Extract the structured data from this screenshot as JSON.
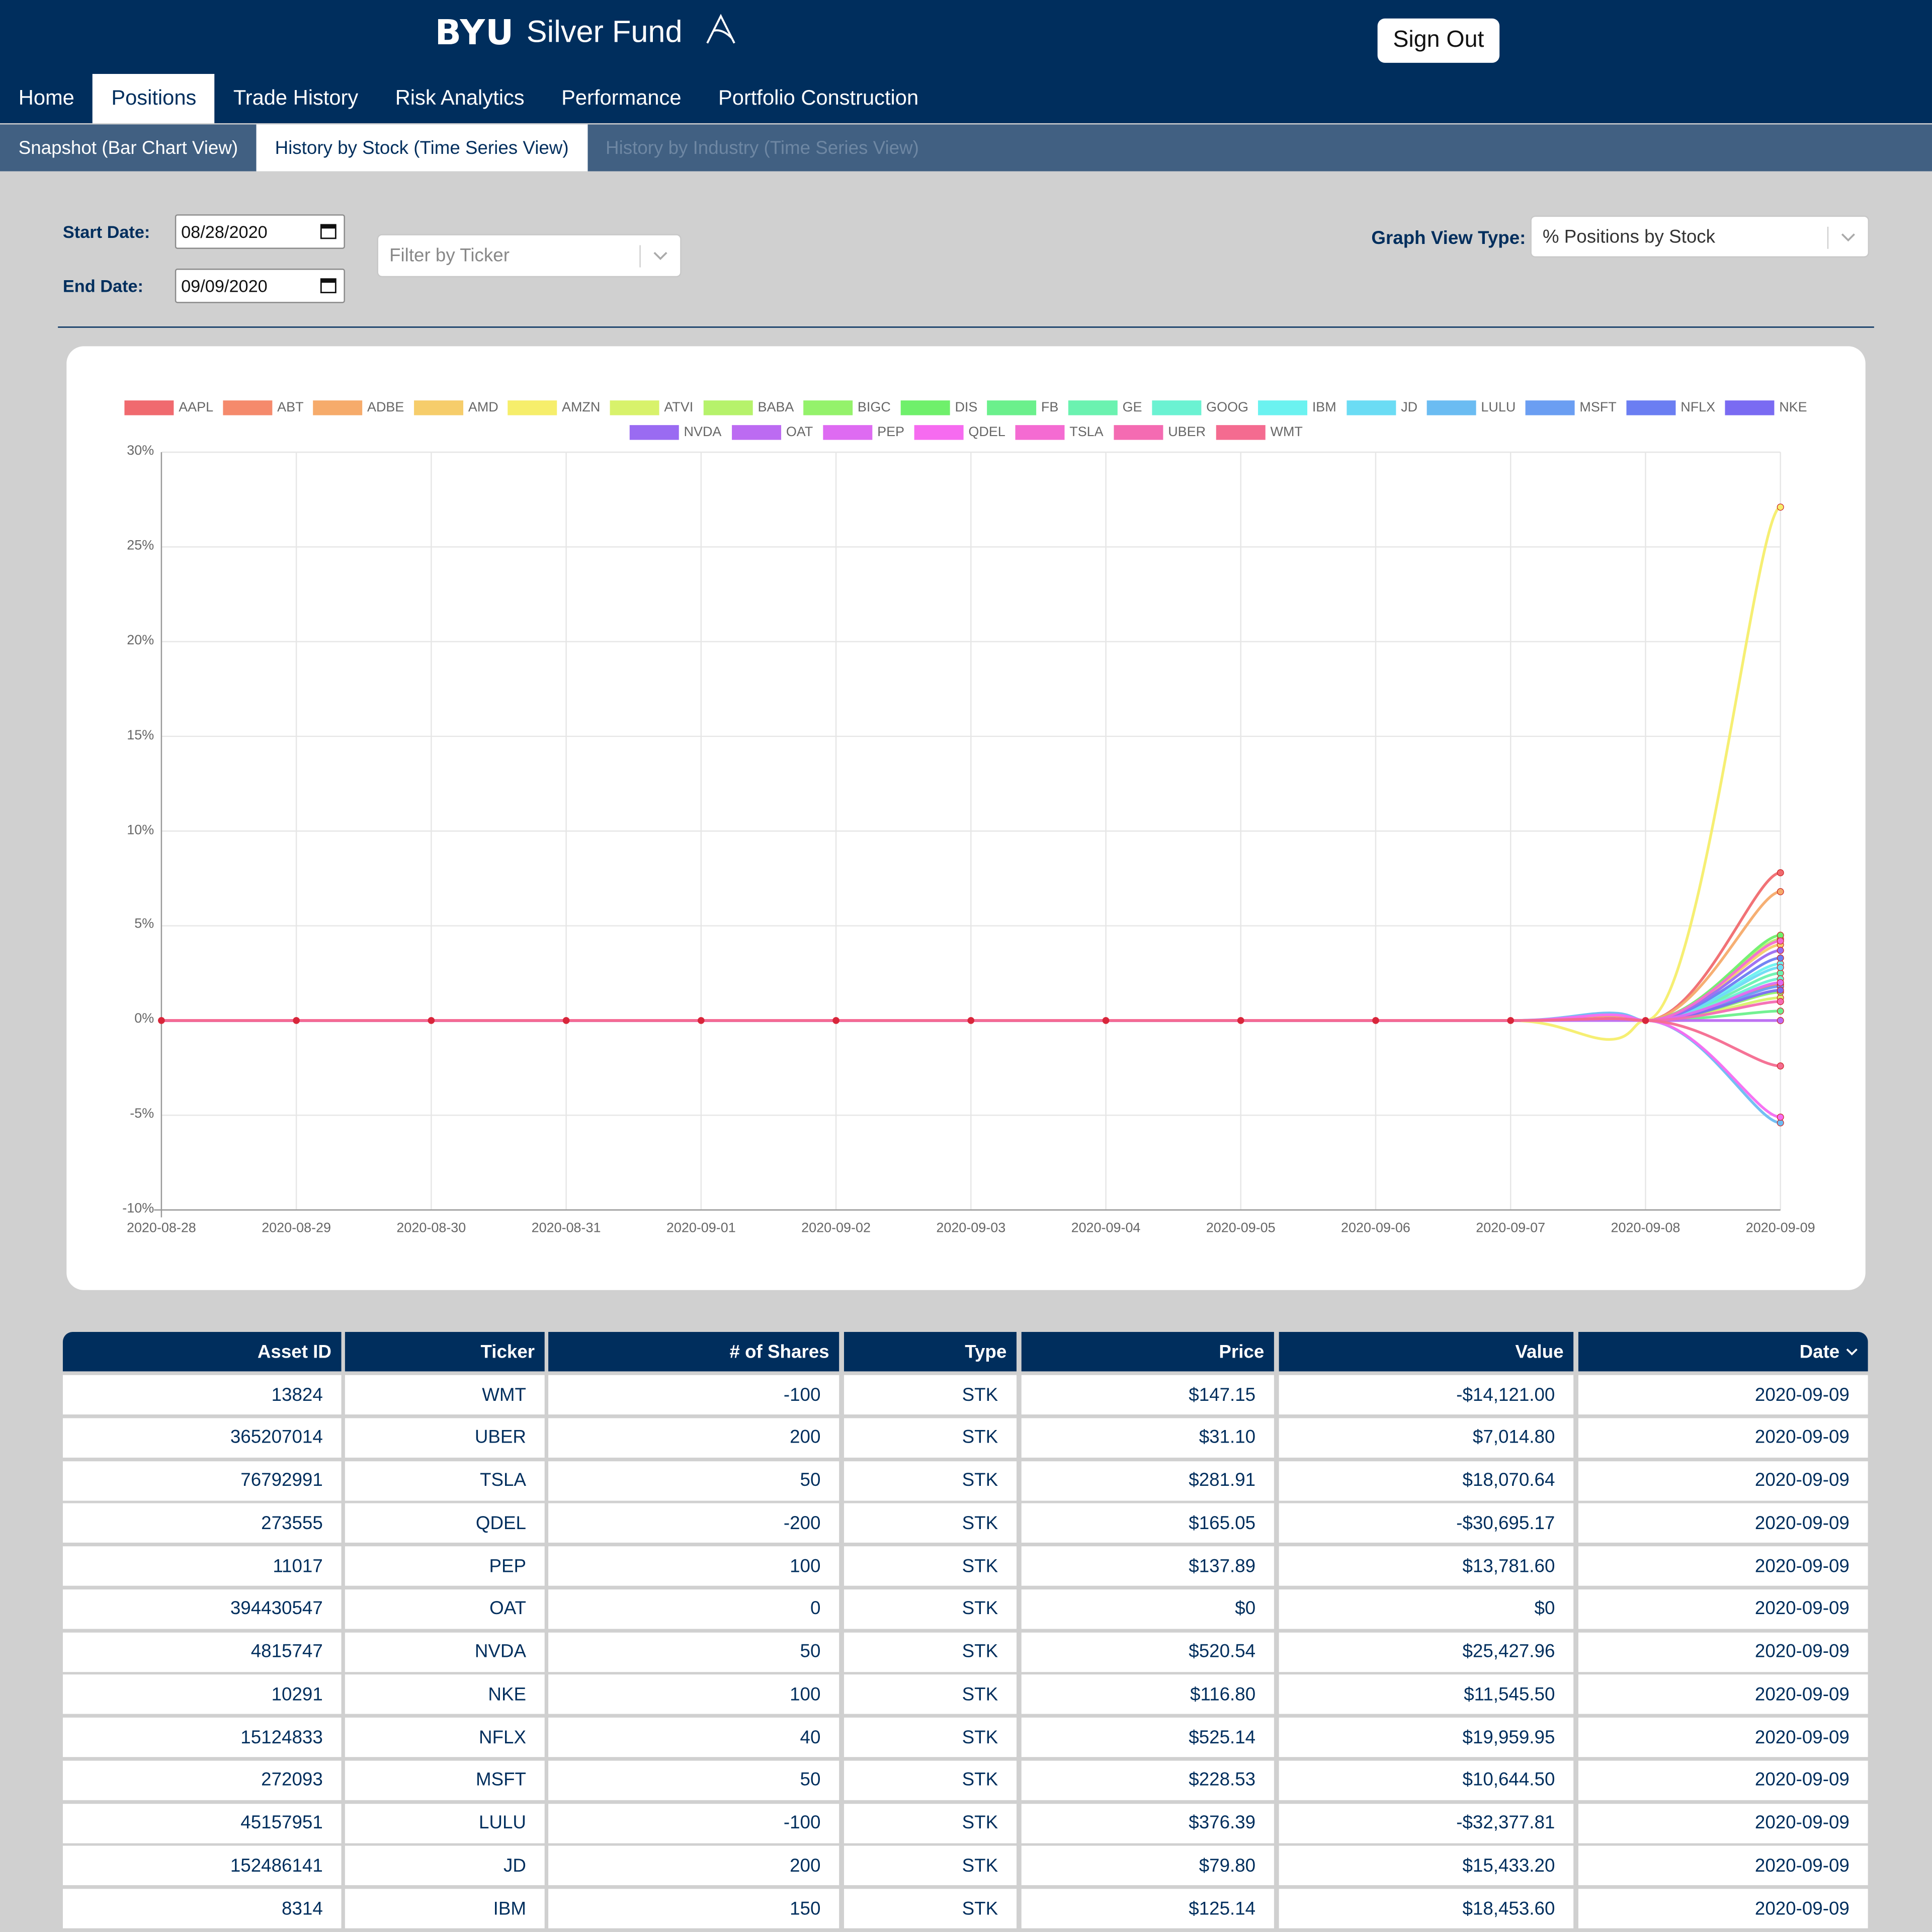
{
  "header": {
    "brand_byu": "BYU",
    "brand_name": "Silver Fund",
    "sign_out": "Sign Out",
    "bg_color": "#002e5d"
  },
  "nav": {
    "items": [
      "Home",
      "Positions",
      "Trade History",
      "Risk Analytics",
      "Performance",
      "Portfolio Construction"
    ],
    "active": "Positions"
  },
  "subnav": {
    "items": [
      "Snapshot (Bar Chart View)",
      "History by Stock (Time Series View)",
      "History by Industry (Time Series View)"
    ],
    "active": "History by Stock (Time Series View)"
  },
  "filters": {
    "start_label": "Start Date:",
    "start_value": "08/28/2020",
    "end_label": "End Date:",
    "end_value": "09/09/2020",
    "ticker_placeholder": "Filter by Ticker",
    "graph_view_label": "Graph View Type:",
    "graph_view_value": "% Positions by Stock"
  },
  "chart_data": {
    "type": "line",
    "x": [
      "2020-08-28",
      "2020-08-29",
      "2020-08-30",
      "2020-08-31",
      "2020-09-01",
      "2020-09-02",
      "2020-09-03",
      "2020-09-04",
      "2020-09-05",
      "2020-09-06",
      "2020-09-07",
      "2020-09-08",
      "2020-09-09"
    ],
    "ylim": [
      -10,
      30
    ],
    "yticks": [
      "30%",
      "25%",
      "20%",
      "15%",
      "10%",
      "5%",
      "0%",
      "-5%",
      "-10%"
    ],
    "grid": true,
    "legend_position": "top",
    "series": [
      {
        "name": "AAPL",
        "color": "#f06a6f",
        "dip": 0.2,
        "final": 7.8
      },
      {
        "name": "ABT",
        "color": "#f58a6c",
        "dip": 0.1,
        "final": 1.9
      },
      {
        "name": "ADBE",
        "color": "#f6ab6b",
        "dip": 0.2,
        "final": 6.8
      },
      {
        "name": "AMD",
        "color": "#f6cd6b",
        "dip": 0.1,
        "final": 4.0
      },
      {
        "name": "AMZN",
        "color": "#f6ee6b",
        "dip": -1.0,
        "final": 27.1
      },
      {
        "name": "ATVI",
        "color": "#d8f26b",
        "dip": 0.1,
        "final": 1.2
      },
      {
        "name": "BABA",
        "color": "#b6f26b",
        "dip": 0.1,
        "final": 4.3
      },
      {
        "name": "BIGC",
        "color": "#94f26b",
        "dip": 0.1,
        "final": 1.5
      },
      {
        "name": "DIS",
        "color": "#6ff06b",
        "dip": 0.1,
        "final": 4.5
      },
      {
        "name": "FB",
        "color": "#6bf08c",
        "dip": 0.1,
        "final": 0.5
      },
      {
        "name": "GE",
        "color": "#6bf2b0",
        "dip": 0.1,
        "final": 2.5
      },
      {
        "name": "GOOG",
        "color": "#6bf2d2",
        "dip": 0.1,
        "final": 2.2
      },
      {
        "name": "IBM",
        "color": "#6bf2f0",
        "dip": 0.1,
        "final": 3.0
      },
      {
        "name": "JD",
        "color": "#6bdcf4",
        "dip": 0.1,
        "final": 2.8
      },
      {
        "name": "LULU",
        "color": "#6bbcf2",
        "dip": 0.4,
        "final": -5.4
      },
      {
        "name": "MSFT",
        "color": "#6b9ef2",
        "dip": 0.1,
        "final": 1.8
      },
      {
        "name": "NFLX",
        "color": "#6b7ef2",
        "dip": 0.1,
        "final": 3.3
      },
      {
        "name": "NKE",
        "color": "#7a6bf2",
        "dip": 0.1,
        "final": 1.6
      },
      {
        "name": "NVDA",
        "color": "#9a6bf2",
        "dip": 0.1,
        "final": 3.7
      },
      {
        "name": "OAT",
        "color": "#bc6bf2",
        "dip": 0.0,
        "final": 0.0
      },
      {
        "name": "PEP",
        "color": "#de6bf2",
        "dip": 0.1,
        "final": 2.0
      },
      {
        "name": "QDEL",
        "color": "#f66bf0",
        "dip": 0.3,
        "final": -5.1
      },
      {
        "name": "TSLA",
        "color": "#f46bd2",
        "dip": 0.1,
        "final": 4.2
      },
      {
        "name": "UBER",
        "color": "#f46bb2",
        "dip": 0.1,
        "final": 1.0
      },
      {
        "name": "WMT",
        "color": "#f46b90",
        "dip": 0.1,
        "final": -2.4
      }
    ]
  },
  "table": {
    "headers": [
      "Asset ID",
      "Ticker",
      "# of Shares",
      "Type",
      "Price",
      "Value",
      "Date"
    ],
    "sort_column": "Date",
    "rows": [
      [
        "13824",
        "WMT",
        "-100",
        "STK",
        "$147.15",
        "-$14,121.00",
        "2020-09-09"
      ],
      [
        "365207014",
        "UBER",
        "200",
        "STK",
        "$31.10",
        "$7,014.80",
        "2020-09-09"
      ],
      [
        "76792991",
        "TSLA",
        "50",
        "STK",
        "$281.91",
        "$18,070.64",
        "2020-09-09"
      ],
      [
        "273555",
        "QDEL",
        "-200",
        "STK",
        "$165.05",
        "-$30,695.17",
        "2020-09-09"
      ],
      [
        "11017",
        "PEP",
        "100",
        "STK",
        "$137.89",
        "$13,781.60",
        "2020-09-09"
      ],
      [
        "394430547",
        "OAT",
        "0",
        "STK",
        "$0",
        "$0",
        "2020-09-09"
      ],
      [
        "4815747",
        "NVDA",
        "50",
        "STK",
        "$520.54",
        "$25,427.96",
        "2020-09-09"
      ],
      [
        "10291",
        "NKE",
        "100",
        "STK",
        "$116.80",
        "$11,545.50",
        "2020-09-09"
      ],
      [
        "15124833",
        "NFLX",
        "40",
        "STK",
        "$525.14",
        "$19,959.95",
        "2020-09-09"
      ],
      [
        "272093",
        "MSFT",
        "50",
        "STK",
        "$228.53",
        "$10,644.50",
        "2020-09-09"
      ],
      [
        "45157951",
        "LULU",
        "-100",
        "STK",
        "$376.39",
        "-$32,377.81",
        "2020-09-09"
      ],
      [
        "152486141",
        "JD",
        "200",
        "STK",
        "$79.80",
        "$15,433.20",
        "2020-09-09"
      ],
      [
        "8314",
        "IBM",
        "150",
        "STK",
        "$125.14",
        "$18,453.60",
        "2020-09-09"
      ]
    ]
  }
}
